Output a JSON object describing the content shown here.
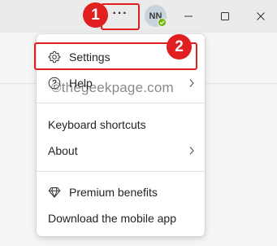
{
  "toolbar": {
    "more_label": "···",
    "avatar_initials": "NN"
  },
  "annotations": {
    "step1": "1",
    "step2": "2"
  },
  "menu": {
    "settings": "Settings",
    "help": "Help",
    "keyboard_shortcuts": "Keyboard shortcuts",
    "about": "About",
    "premium_benefits": "Premium benefits",
    "download_mobile": "Download the mobile app"
  },
  "watermark": "©thegeekpage.com",
  "colors": {
    "annotation_red": "#e02020",
    "presence_green": "#6bb700",
    "titlebar_bg": "#ebebeb"
  },
  "icons": {
    "more": "more-horizontal-icon",
    "settings": "gear-icon",
    "help": "question-circle-icon",
    "premium": "diamond-icon",
    "submenu": "chevron-right-icon",
    "minimize": "minimize-icon",
    "maximize": "maximize-icon",
    "close": "close-icon"
  }
}
